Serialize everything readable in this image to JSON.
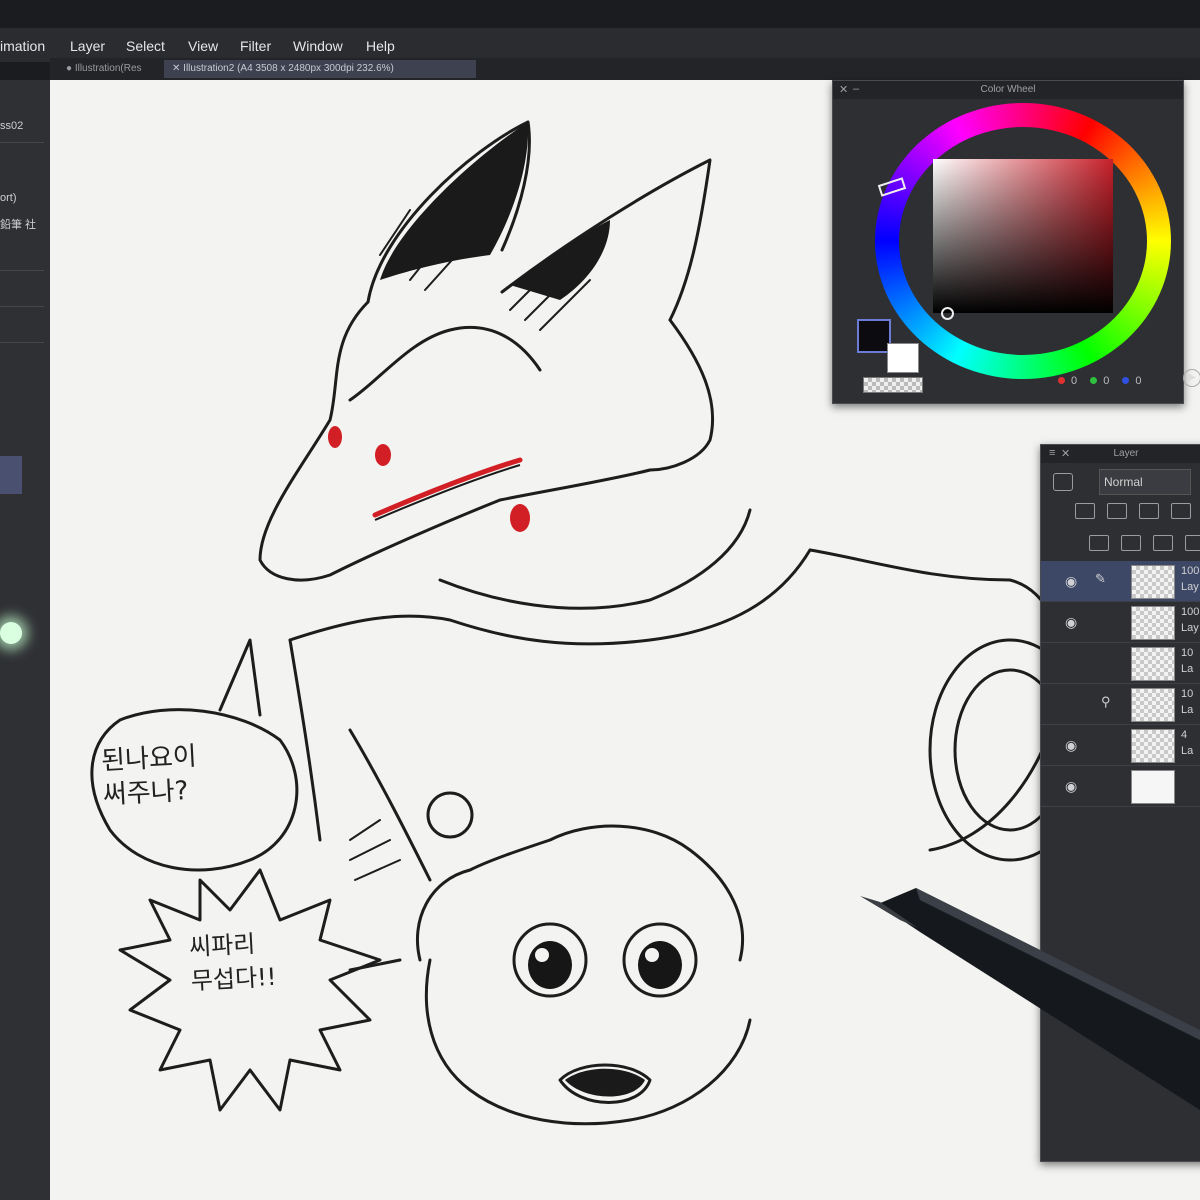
{
  "menu": {
    "items": [
      "imation",
      "Layer",
      "Select",
      "View",
      "Filter",
      "Window",
      "Help"
    ]
  },
  "tabs": [
    {
      "label": "Illustration(Res"
    },
    {
      "label": "Illustration2 (A4 3508 x 2480px 300dpi 232.6%)"
    }
  ],
  "left_panel": {
    "labels": [
      "ss02",
      "ort)",
      "鉛筆 社"
    ]
  },
  "color_wheel": {
    "title": "Color Wheel",
    "main_color": "#0c0c10",
    "sub_color": "#ffffff",
    "hue_color": "#c8202a",
    "r": "0",
    "g": "0",
    "b": "0"
  },
  "layer_panel": {
    "title": "Layer",
    "blend_mode": "Normal",
    "layers": [
      {
        "opacity": "100",
        "name": "Lay",
        "visible": true,
        "selected": true
      },
      {
        "opacity": "100",
        "name": "Lay",
        "visible": true,
        "selected": false
      },
      {
        "opacity": "10",
        "name": "La",
        "visible": false,
        "selected": false
      },
      {
        "opacity": "10",
        "name": "La",
        "visible": false,
        "selected": false
      },
      {
        "opacity": "4",
        "name": "La",
        "visible": true,
        "selected": false
      },
      {
        "opacity": "",
        "name": "",
        "visible": true,
        "selected": false
      }
    ]
  },
  "drawing": {
    "speech_bubble_1": [
      "된나요이",
      "써주나?"
    ],
    "speech_bubble_2": [
      "씨파리",
      "무섭다!!"
    ],
    "accent_color": "#d21f26"
  }
}
